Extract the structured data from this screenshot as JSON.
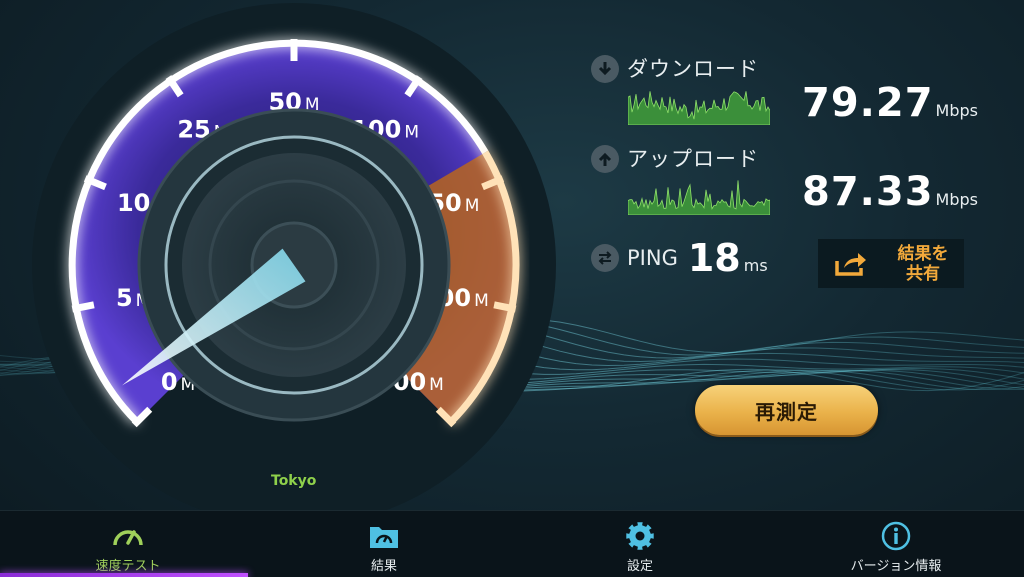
{
  "gauge": {
    "labels": [
      {
        "num": "0",
        "unit": "M"
      },
      {
        "num": "5",
        "unit": "M"
      },
      {
        "num": "10",
        "unit": "M"
      },
      {
        "num": "25",
        "unit": "M"
      },
      {
        "num": "50",
        "unit": "M"
      },
      {
        "num": "100",
        "unit": "M"
      },
      {
        "num": "150",
        "unit": "M"
      },
      {
        "num": "300",
        "unit": "M"
      },
      {
        "num": "500",
        "unit": "M"
      }
    ],
    "server": "Tokyo"
  },
  "download": {
    "label": "ダウンロード",
    "value": "79.27",
    "unit": "Mbps"
  },
  "upload": {
    "label": "アップロード",
    "value": "87.33",
    "unit": "Mbps"
  },
  "ping": {
    "label": "PING",
    "value": "18",
    "unit": "ms"
  },
  "share": {
    "label": "結果を\n共有"
  },
  "retest": {
    "label": "再測定"
  },
  "tabs": [
    {
      "label": "速度テスト",
      "icon": "speedometer-icon",
      "active": true
    },
    {
      "label": "結果",
      "icon": "folder-gauge-icon",
      "active": false
    },
    {
      "label": "設定",
      "icon": "gear-icon",
      "active": false
    },
    {
      "label": "バージョン情報",
      "icon": "info-icon",
      "active": false
    }
  ],
  "colors": {
    "gauge_purple": "#5a3fd0",
    "gauge_orange": "#e88a2e",
    "accent_green": "#9fd05a",
    "button_gold": "#eab24a",
    "share_text": "#f2a93b"
  }
}
